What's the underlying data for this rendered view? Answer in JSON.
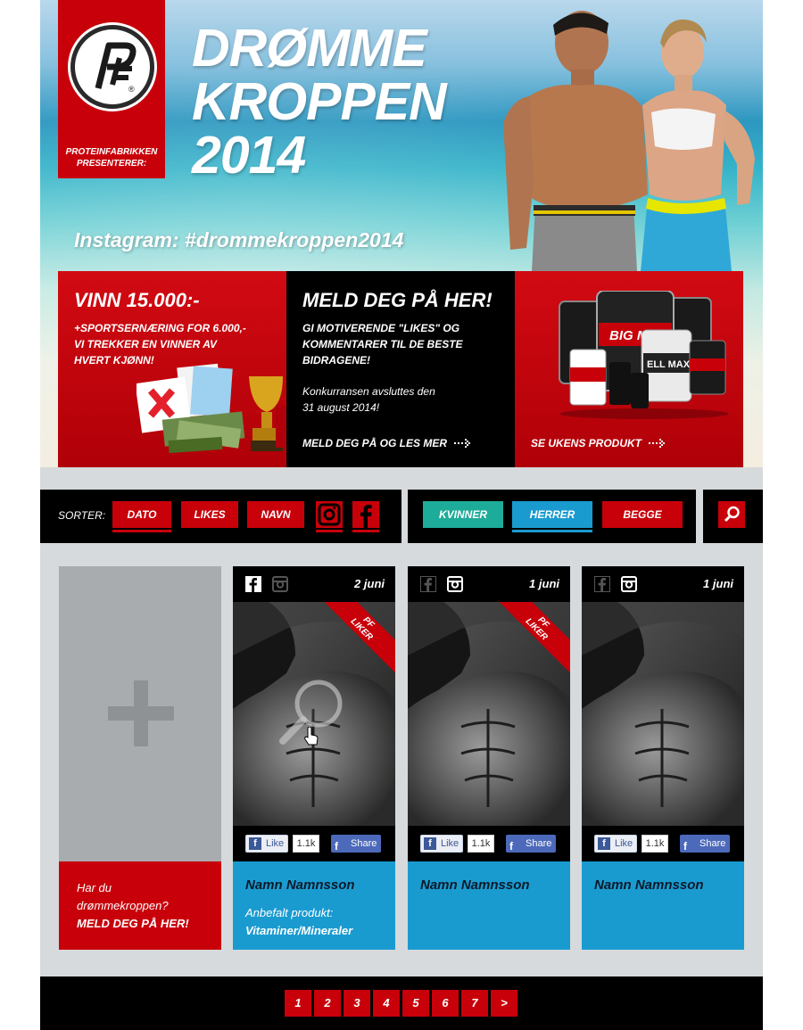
{
  "hero": {
    "logo_caption_line1": "PROTEINFABRIKKEN",
    "logo_caption_line2": "PRESENTERER:",
    "title_line1": "DRØMME",
    "title_line2": "KROPPEN",
    "title_line3": "2014",
    "instagram_tag": "Instagram: #drommekroppen2014"
  },
  "promo": {
    "win": {
      "title": "VINN 15.000:-",
      "line1": "+SPORTSERNÆRING FOR 6.000,-",
      "line2": "VI TREKKER EN VINNER AV",
      "line3": "HVERT KJØNN!"
    },
    "signup": {
      "title": "MELD DEG PÅ HER!",
      "line1": "GI MOTIVERENDE \"LIKES\" OG",
      "line2": "KOMMENTARER TIL DE BESTE",
      "line3": "BIDRAGENE!",
      "end_line1": "Konkurransen avsluttes den",
      "end_line2": "31 august 2014!",
      "link": "MELD DEG PÅ OG LES MER"
    },
    "product": {
      "link": "SE UKENS PRODUKT"
    }
  },
  "filters": {
    "sort_label": "SORTER:",
    "sort_buttons": [
      "DATO",
      "LIKES",
      "NAVN"
    ],
    "gender_buttons": [
      "KVINNER",
      "HERRER",
      "BEGGE"
    ]
  },
  "add_card": {
    "line1": "Har du",
    "line2": "drømmekroppen?",
    "line3": "MELD DEG PÅ HER!"
  },
  "cards": [
    {
      "date": "2 juni",
      "badge_line1": "PF",
      "badge_line2": "LIKER",
      "like": "Like",
      "count": "1.1k",
      "share": "Share",
      "name": "Namn Namnsson",
      "rec_label": "Anbefalt produkt:",
      "rec_value": "Vitaminer/Mineraler"
    },
    {
      "date": "1 juni",
      "badge_line1": "PF",
      "badge_line2": "LIKER",
      "like": "Like",
      "count": "1.1k",
      "share": "Share",
      "name": "Namn Namnsson"
    },
    {
      "date": "1 juni",
      "like": "Like",
      "count": "1.1k",
      "share": "Share",
      "name": "Namn Namnsson"
    }
  ],
  "pager": [
    "1",
    "2",
    "3",
    "4",
    "5",
    "6",
    "7",
    ">"
  ],
  "colors": {
    "brand_red": "#c8000a",
    "teal": "#1eac9a",
    "blue": "#1a9bd0",
    "black": "#000000"
  }
}
